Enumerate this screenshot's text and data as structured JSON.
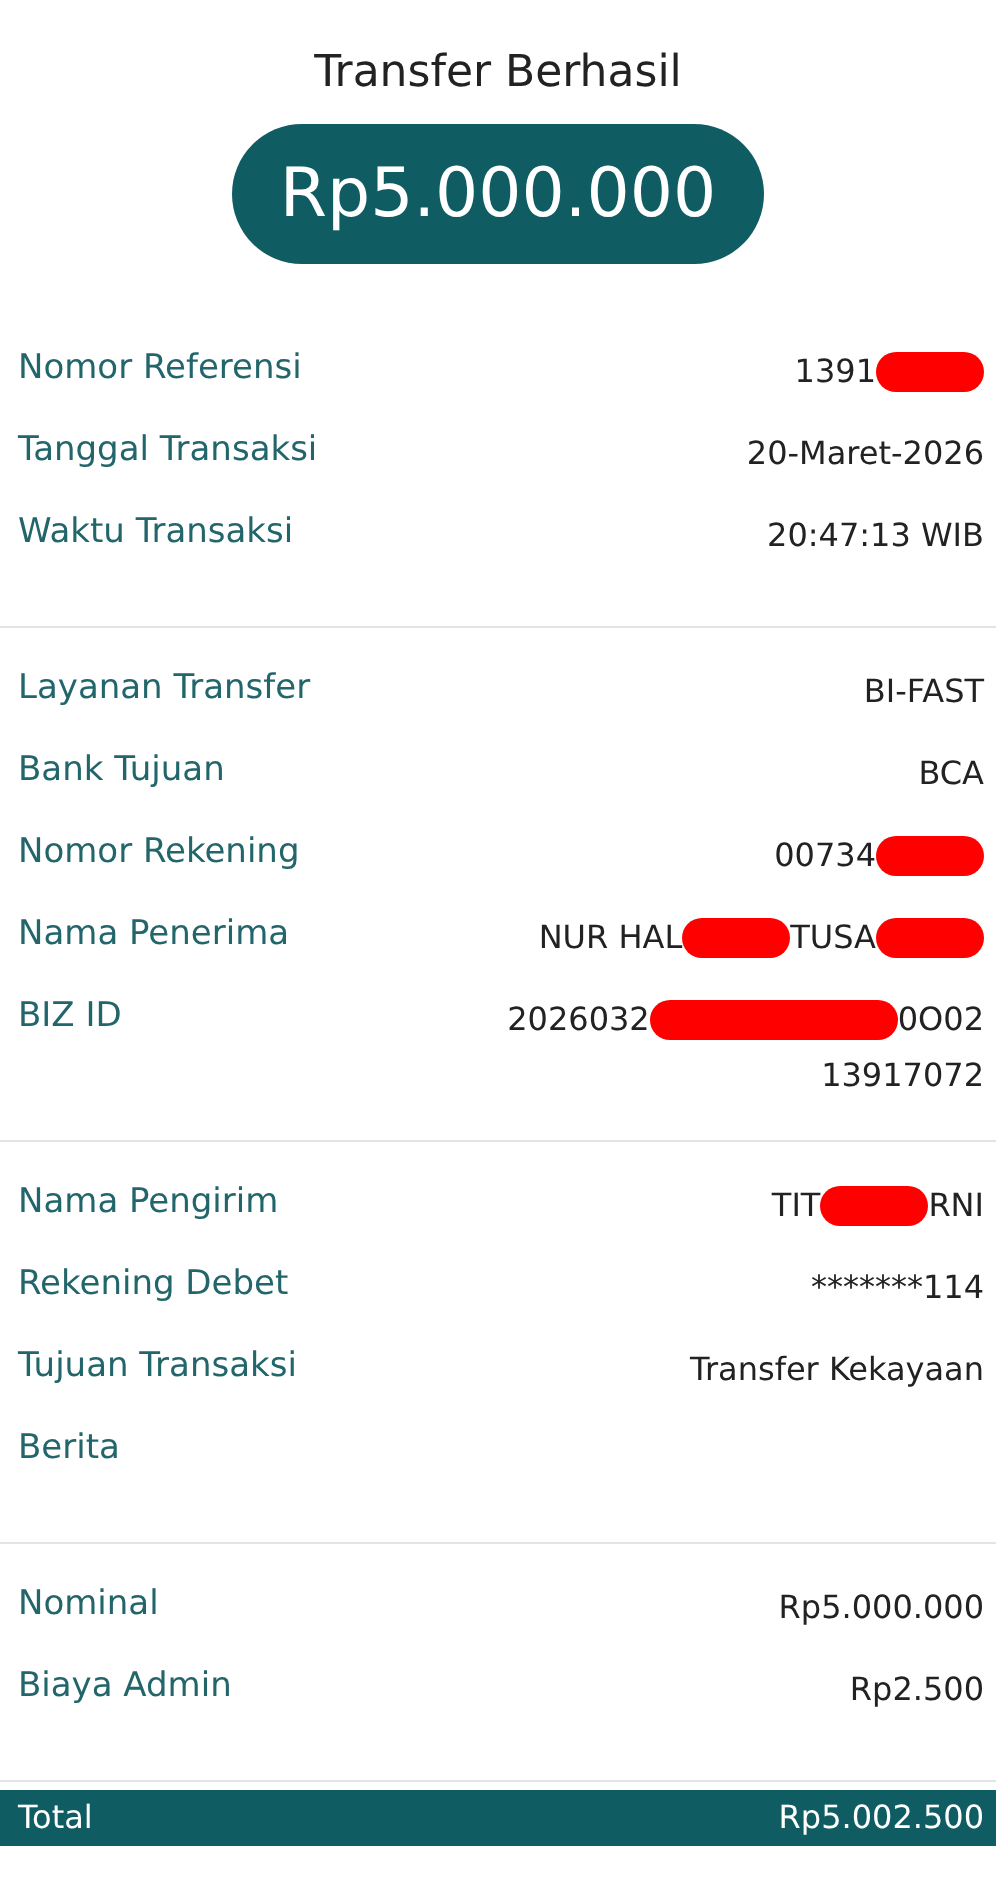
{
  "title": "Transfer Berhasil",
  "amount": "Rp5.000.000",
  "sections": [
    {
      "rows": [
        {
          "label": "Nomor Referensi",
          "lines": [
            [
              {
                "kind": "text",
                "text": "1391"
              },
              {
                "kind": "redaction"
              }
            ]
          ]
        },
        {
          "label": "Tanggal Transaksi",
          "lines": [
            [
              {
                "kind": "text",
                "text": "20-Maret-2026"
              }
            ]
          ]
        },
        {
          "label": "Waktu Transaksi",
          "lines": [
            [
              {
                "kind": "text",
                "text": "20:47:13 WIB"
              }
            ]
          ]
        }
      ]
    },
    {
      "rows": [
        {
          "label": "Layanan Transfer",
          "lines": [
            [
              {
                "kind": "text",
                "text": "BI-FAST"
              }
            ]
          ]
        },
        {
          "label": "Bank Tujuan",
          "lines": [
            [
              {
                "kind": "text",
                "text": "BCA"
              }
            ]
          ]
        },
        {
          "label": "Nomor Rekening",
          "lines": [
            [
              {
                "kind": "text",
                "text": "00734"
              },
              {
                "kind": "redaction"
              }
            ]
          ]
        },
        {
          "label": "Nama Penerima",
          "lines": [
            [
              {
                "kind": "text",
                "text": "NUR HAL"
              },
              {
                "kind": "redaction"
              },
              {
                "kind": "text",
                "text": "TUSA"
              },
              {
                "kind": "redaction"
              }
            ]
          ]
        },
        {
          "label": "BIZ ID",
          "lines": [
            [
              {
                "kind": "text",
                "text": "2026032"
              },
              {
                "kind": "redaction-long"
              },
              {
                "kind": "text",
                "text": "0O02"
              }
            ],
            [
              {
                "kind": "text",
                "text": "13917072"
              }
            ]
          ]
        }
      ]
    },
    {
      "rows": [
        {
          "label": "Nama Pengirim",
          "lines": [
            [
              {
                "kind": "text",
                "text": "TIT"
              },
              {
                "kind": "redaction"
              },
              {
                "kind": "text",
                "text": "RNI"
              }
            ]
          ]
        },
        {
          "label": "Rekening Debet",
          "lines": [
            [
              {
                "kind": "text",
                "text": "*******114"
              }
            ]
          ]
        },
        {
          "label": "Tujuan Transaksi",
          "lines": [
            [
              {
                "kind": "text",
                "text": "Transfer Kekayaan"
              }
            ]
          ]
        },
        {
          "label": "Berita"
        }
      ]
    },
    {
      "rows": [
        {
          "label": "Nominal",
          "lines": [
            [
              {
                "kind": "text",
                "text": "Rp5.000.000"
              }
            ]
          ]
        },
        {
          "label": "Biaya Admin",
          "lines": [
            [
              {
                "kind": "text",
                "text": "Rp2.500"
              }
            ]
          ]
        }
      ]
    }
  ],
  "total": {
    "label": "Total",
    "value": "Rp5.002.500"
  }
}
